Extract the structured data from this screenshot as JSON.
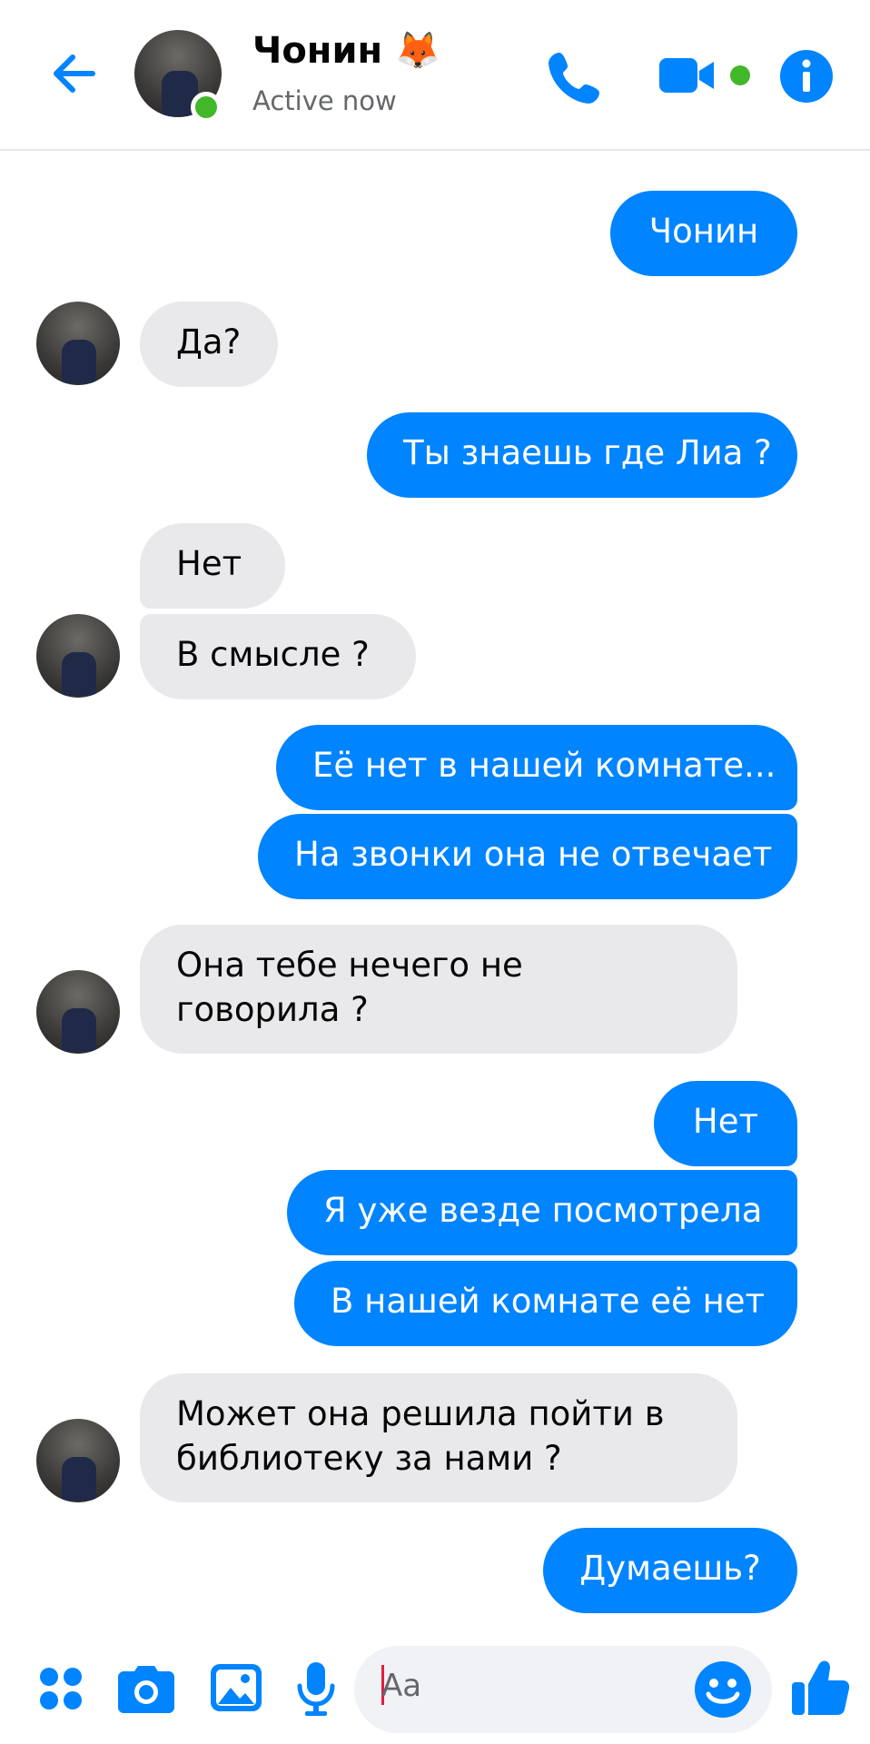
{
  "header": {
    "contact_name": "Чонин",
    "contact_emoji": "🦊",
    "status": "Active now"
  },
  "messages": [
    {
      "side": "out",
      "text": "Чонин"
    },
    {
      "side": "in",
      "text": "Да?"
    },
    {
      "side": "out",
      "text": "Ты знаешь где Лиа ?"
    },
    {
      "side": "in",
      "text": "Нет"
    },
    {
      "side": "in",
      "text": "В смысле ?"
    },
    {
      "side": "out",
      "text": "Её нет в нашей комнате..."
    },
    {
      "side": "out",
      "text": "На звонки она не отвечает"
    },
    {
      "side": "in",
      "text_line1": "Она тебе нечего не",
      "text_line2": "говорила ?"
    },
    {
      "side": "out",
      "text": "Нет"
    },
    {
      "side": "out",
      "text": "Я уже везде посмотрела"
    },
    {
      "side": "out",
      "text": "В нашей комнате её нет"
    },
    {
      "side": "in",
      "text_line1": "Может она решила пойти в",
      "text_line2": "библиотеку за нами ?"
    },
    {
      "side": "out",
      "text": "Думаешь?"
    }
  ],
  "composer": {
    "placeholder": "Aa"
  },
  "colors": {
    "accent": "#0084ff",
    "incoming_bubble": "#e9e9eb",
    "active_green": "#42b72a"
  },
  "icons": {
    "back": "back-arrow-icon",
    "call": "phone-icon",
    "video": "video-camera-icon",
    "info": "info-icon",
    "menu": "four-dots-icon",
    "camera": "camera-icon",
    "gallery": "image-icon",
    "mic": "microphone-icon",
    "emoji": "smiley-icon",
    "like": "thumbs-up-icon"
  }
}
